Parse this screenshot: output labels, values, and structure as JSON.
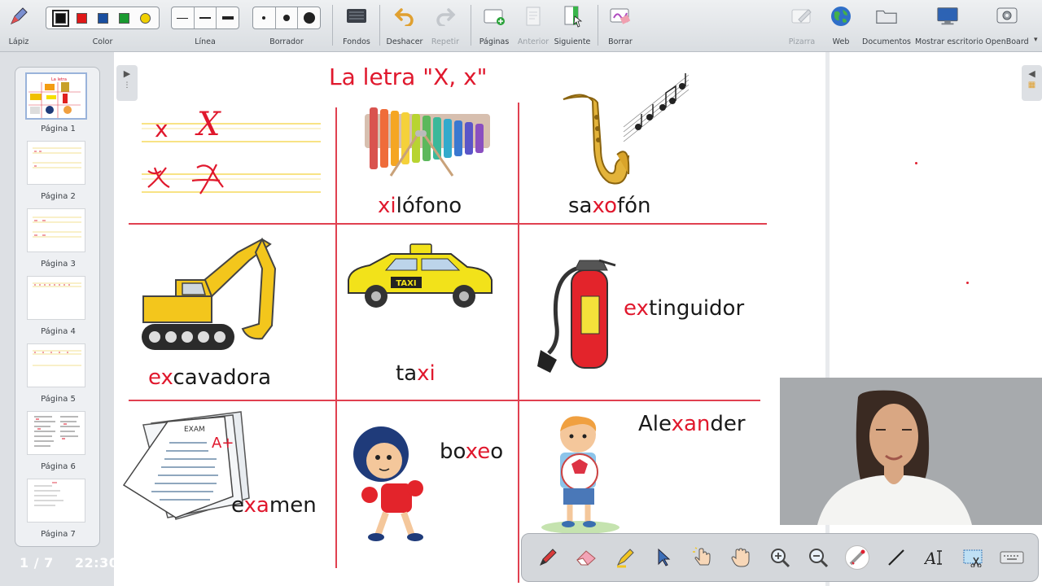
{
  "toolbar": {
    "pen_label": "Lápiz",
    "color_label": "Color",
    "colors": [
      "#111111",
      "#e01818",
      "#1a4fa0",
      "#1a9a30",
      "#f0d000"
    ],
    "line_label": "Línea",
    "eraser_label": "Borrador",
    "backgrounds_label": "Fondos",
    "undo_label": "Deshacer",
    "redo_label": "Repetir",
    "pages_label": "Páginas",
    "previous_label": "Anterior",
    "next_label": "Siguiente",
    "clear_label": "Borrar",
    "board_label": "Pizarra",
    "web_label": "Web",
    "documents_label": "Documentos",
    "desktop_label": "Mostrar escritorio",
    "openboard_label": "OpenBoard"
  },
  "sidebar": {
    "pages": [
      {
        "label": "Página 1"
      },
      {
        "label": "Página 2"
      },
      {
        "label": "Página 3"
      },
      {
        "label": "Página 4"
      },
      {
        "label": "Página 5"
      },
      {
        "label": "Página 6"
      },
      {
        "label": "Página 7"
      }
    ],
    "page_counter": "1 / 7",
    "time": "22:30"
  },
  "board": {
    "title": "La letra \"X, x\"",
    "handwriting": {
      "print_lower": "x",
      "print_upper": "X"
    },
    "words": {
      "xilofono": {
        "hl": "xi",
        "rest": "lófono"
      },
      "saxofon": {
        "pre": "sa",
        "hl": "xo",
        "rest": "fón"
      },
      "excavadora": {
        "hl": "ex",
        "rest": "cavadora"
      },
      "taxi": {
        "pre": "ta",
        "hl": "xi"
      },
      "extinguidor": {
        "hl": "ex",
        "rest": "tinguidor"
      },
      "examen": {
        "pre": "e",
        "hl": "xa",
        "rest": "men"
      },
      "boxeo": {
        "pre": "bo",
        "hl": "xe",
        "rest": "o"
      },
      "alexander": {
        "pre": "Ale",
        "hl": "xan",
        "rest": "der"
      }
    },
    "taxi_sign": "TAXI",
    "exam_paper": {
      "header": "EXAM",
      "grade": "A+"
    }
  },
  "icons": {
    "bottom_tools": [
      "pen-icon",
      "eraser-icon",
      "highlighter-icon",
      "pointer-icon",
      "interact-hand-icon",
      "pan-hand-icon",
      "zoom-in-icon",
      "zoom-out-icon",
      "laser-pointer-icon",
      "line-icon",
      "text-icon",
      "capture-icon",
      "keyboard-icon"
    ]
  }
}
